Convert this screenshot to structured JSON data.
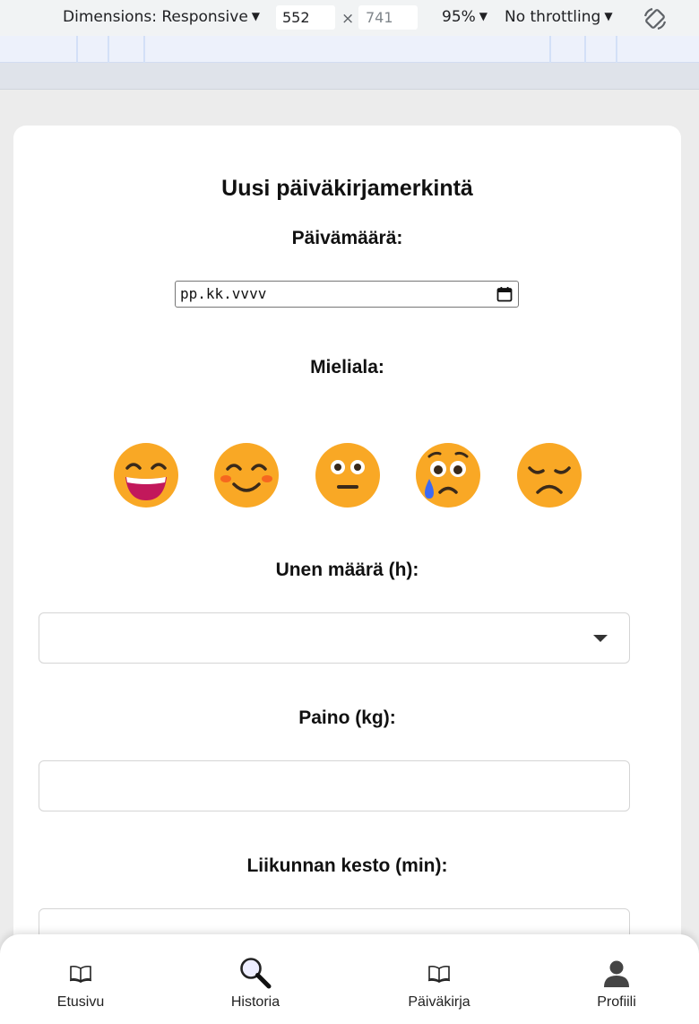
{
  "devtools": {
    "dimensions_label": "Dimensions: Responsive",
    "width_value": "552",
    "height_placeholder": "741",
    "zoom": "95%",
    "throttling": "No throttling",
    "times": "×"
  },
  "form": {
    "title": "Uusi päiväkirjamerkintä",
    "date_label": "Päivämäärä:",
    "date_placeholder": "pp.kk.vvvv",
    "mood_label": "Mieliala:",
    "moods": [
      "grinning-face-icon",
      "smiling-face-icon",
      "neutral-face-icon",
      "crying-face-icon",
      "sad-face-icon"
    ],
    "sleep_label": "Unen määrä (h):",
    "sleep_value": "",
    "weight_label": "Paino (kg):",
    "weight_value": "",
    "exercise_label": "Liikunnan kesto (min):",
    "exercise_value": ""
  },
  "nav": {
    "items": [
      {
        "label": "Etusivu",
        "icon": "book-icon"
      },
      {
        "label": "Historia",
        "icon": "magnifier-icon"
      },
      {
        "label": "Päiväkirja",
        "icon": "book-icon"
      },
      {
        "label": "Profiili",
        "icon": "user-icon"
      }
    ]
  },
  "colors": {
    "emoji_face": "#F9A825",
    "emoji_mouth": "#C2185B",
    "tear": "#3D6AF2"
  }
}
